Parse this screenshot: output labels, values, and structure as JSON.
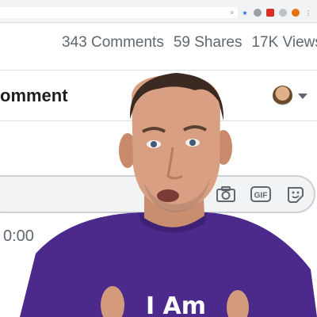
{
  "stats": {
    "comments": "343 Comments",
    "shares": "59 Shares",
    "views": "17K Views"
  },
  "comment_section": {
    "header": "omment",
    "time": "0:00"
  },
  "input_icons": [
    "camera-icon",
    "gif-icon",
    "sticker-icon"
  ],
  "shirt": {
    "text": "I Am"
  },
  "colors": {
    "stats_text": "#606770",
    "header_text": "#1c1e21",
    "shirt": "#4b2a8c",
    "input_bg": "#f2f3f5"
  }
}
